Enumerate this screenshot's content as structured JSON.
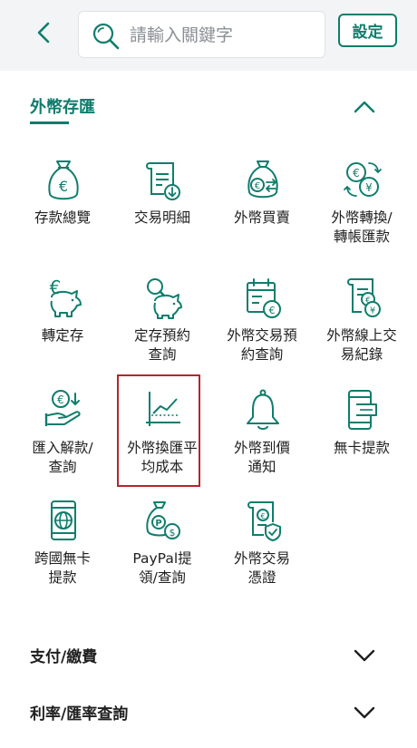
{
  "header": {
    "back_icon": "chevron-left-icon",
    "search": {
      "placeholder": "請輸入關鍵字",
      "value": "",
      "icon": "search-icon"
    },
    "settings_label": "設定"
  },
  "section": {
    "title": "外幣存匯",
    "state": "expanded",
    "collapse_icon": "chevron-up-icon",
    "accent_color": "#0f7d6c",
    "items": [
      {
        "label": "存款總覽",
        "icon": "euro-money-bag-icon"
      },
      {
        "label": "交易明細",
        "icon": "receipt-download-icon"
      },
      {
        "label": "外幣買賣",
        "icon": "currency-exchange-bag-icon"
      },
      {
        "label": "外幣轉換/\n轉帳匯款",
        "icon": "currency-convert-icon"
      },
      {
        "label": "轉定存",
        "icon": "euro-piggy-bank-icon"
      },
      {
        "label": "定存預約\n查詢",
        "icon": "piggy-bank-search-icon"
      },
      {
        "label": "外幣交易預\n約查詢",
        "icon": "calendar-currency-icon"
      },
      {
        "label": "外幣線上交\n易紀錄",
        "icon": "document-yen-icon"
      },
      {
        "label": "匯入解款/\n查詢",
        "icon": "hand-euro-coin-icon"
      },
      {
        "label": "外幣換匯平\n均成本",
        "icon": "line-chart-icon"
      },
      {
        "label": "外幣到價\n通知",
        "icon": "bell-icon"
      },
      {
        "label": "無卡提款",
        "icon": "phone-withdraw-icon"
      },
      {
        "label": "跨國無卡\n提款",
        "icon": "phone-globe-icon"
      },
      {
        "label": "PayPal提\n領/查詢",
        "icon": "paypal-dollar-bag-icon"
      },
      {
        "label": "外幣交易\n憑證",
        "icon": "euro-certificate-icon"
      }
    ],
    "highlighted_item": "外幣換匯平\n均成本",
    "highlight_color": "#b3262c"
  },
  "collapsed_sections": [
    {
      "label": "支付/繳費",
      "icon": "chevron-down-icon"
    },
    {
      "label": "利率/匯率查詢",
      "icon": "chevron-down-icon"
    }
  ]
}
